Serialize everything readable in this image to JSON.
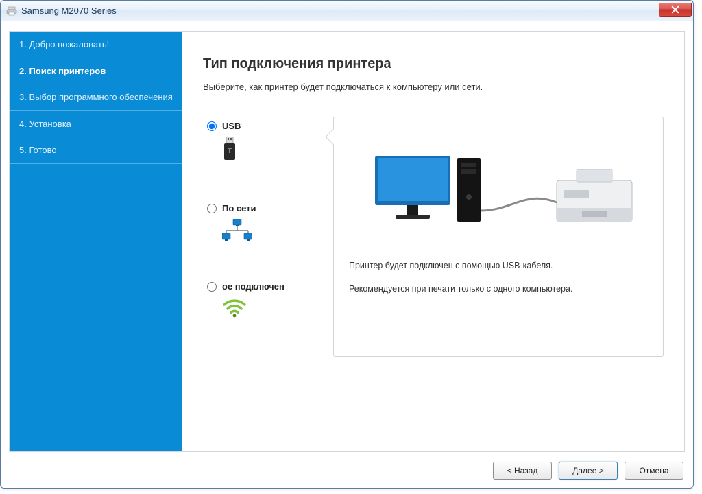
{
  "window": {
    "title": "Samsung M2070 Series"
  },
  "sidebar": {
    "steps": [
      {
        "label": "1. Добро пожаловать!"
      },
      {
        "label": "2. Поиск принтеров"
      },
      {
        "label": "3. Выбор программного обеспечения"
      },
      {
        "label": "4. Установка"
      },
      {
        "label": "5. Готово"
      }
    ],
    "active_index": 1
  },
  "main": {
    "heading": "Тип подключения принтера",
    "subtitle": "Выберите, как принтер будет подключаться к компьютеру или сети.",
    "options": [
      {
        "id": "usb",
        "label": "USB",
        "selected": true,
        "icon": "usb-icon"
      },
      {
        "id": "network",
        "label": "По сети",
        "selected": false,
        "icon": "network-icon"
      },
      {
        "id": "wireless",
        "label": "ое подключен",
        "selected": false,
        "icon": "wifi-icon"
      }
    ],
    "preview": {
      "line1": "Принтер будет подключен с помощью USB-кабеля.",
      "line2": "Рекомендуется при печати только с одного компьютера."
    }
  },
  "buttons": {
    "back": "< Назад",
    "next": "Далее >",
    "cancel": "Отмена"
  }
}
